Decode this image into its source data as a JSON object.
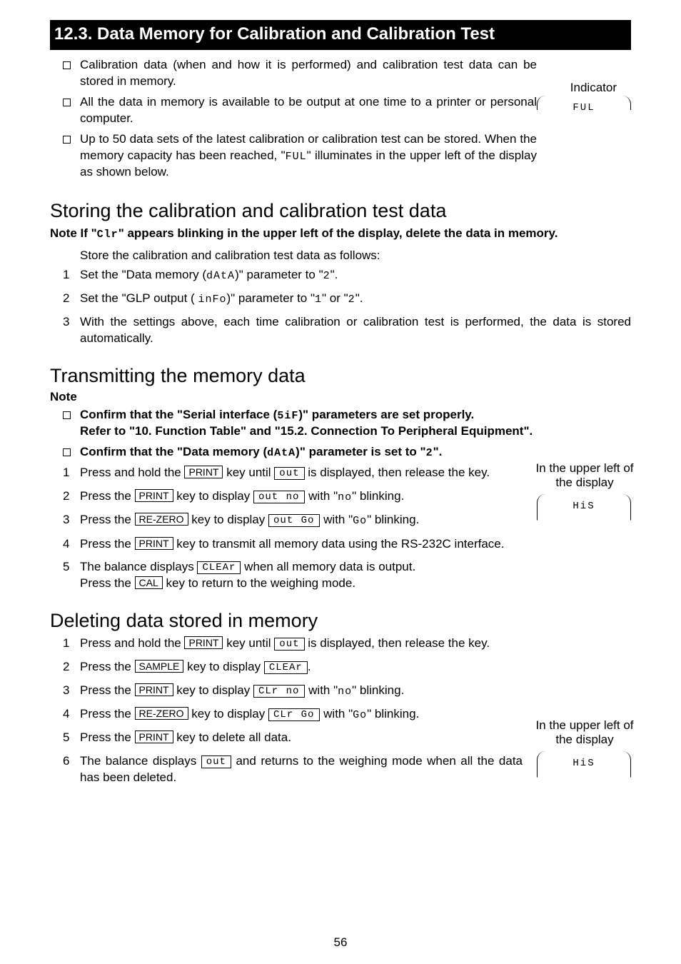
{
  "section": {
    "title": "12.3. Data Memory for Calibration and Calibration Test"
  },
  "intro_bullets": [
    "Calibration data (when and how it is performed) and calibration test data can be stored in memory.",
    "All the data in memory is available to be output at one time to a printer or personal computer.",
    "Up to 50 data sets of the latest calibration or calibration test can be stored. When the memory capacity has been reached, \""
  ],
  "intro_tail": "\" illuminates in the upper left of the display as shown below.",
  "seg": {
    "ful": "FUL",
    "data": "dAtA",
    "two": "2",
    "info": "inFo",
    "one": "1",
    "sif": "5iF",
    "out": "out",
    "out_no": "out no",
    "no": "no",
    "out_go": "out Go",
    "go": "Go",
    "clear": "CLEAr",
    "clr_no": "CLr no",
    "clr_go": "CLr Go",
    "his": "HiS",
    "clr": "Clr"
  },
  "indicator": {
    "label": "Indicator"
  },
  "storing": {
    "title": "Storing the calibration and calibration test data",
    "note_pre": "Note   If \"",
    "note_post": "\" appears blinking in the upper left of the display, delete the data in memory.",
    "intro": "Store the calibration and calibration test data as follows:",
    "items": {
      "s1a": "Set the \"Data memory (",
      "s1b": ")\" parameter to \"",
      "s1c": "\".",
      "s2a": "Set the \"GLP output ( ",
      "s2b": ")\" parameter to \"",
      "s2c": "\" or \"",
      "s2d": "\".",
      "s3": "With the settings above, each time calibration or calibration test is performed, the data is stored automatically."
    }
  },
  "transmitting": {
    "title": "Transmitting the memory data",
    "note": "Note",
    "b1a": "Confirm that the \"Serial interface (",
    "b1b": ")\" parameters are set properly.",
    "b1c": "Refer to \"10. Function Table\" and \"15.2. Connection To Peripheral Equipment\".",
    "b2a": "Confirm that the \"Data memory (",
    "b2b": ")\" parameter is set to \"",
    "b2c": "\".",
    "t1a": "Press and hold the ",
    "t1b": " key until ",
    "t1c": " is displayed, then release the key.",
    "t2a": "Press the ",
    "t2b": " key to display ",
    "t2c": " with \"",
    "t2d": "\" blinking.",
    "t3a": "Press the ",
    "t3b": " key to display ",
    "t3c": " with \"",
    "t3d": "\" blinking.",
    "t4a": "Press the ",
    "t4b": " key to transmit all memory data using the RS-232C interface.",
    "t5a": "The balance displays ",
    "t5b": " when all memory data is output.",
    "t5c": "Press the ",
    "t5d": " key to return to the weighing mode.",
    "label": "In the upper left of the display"
  },
  "deleting": {
    "title": "Deleting data stored in memory",
    "d1a": "Press and hold the ",
    "d1b": " key until ",
    "d1c": " is displayed, then release the key.",
    "d2a": "Press the ",
    "d2b": " key to display ",
    "d2c": ".",
    "d3a": "Press the ",
    "d3b": " key to display ",
    "d3c": " with \"",
    "d3d": "\" blinking.",
    "d4a": "Press the ",
    "d4b": " key to display ",
    "d4c": " with \"",
    "d4d": "\" blinking.",
    "d5a": "Press the ",
    "d5b": " key to delete all data.",
    "d6a": "The balance displays ",
    "d6b": " and returns to the weighing mode when all the data has been deleted.",
    "label": "In the upper left of the display"
  },
  "keys": {
    "print": "PRINT",
    "rezero": "RE-ZERO",
    "cal": "CAL",
    "sample": "SAMPLE"
  },
  "pagenum": "56"
}
